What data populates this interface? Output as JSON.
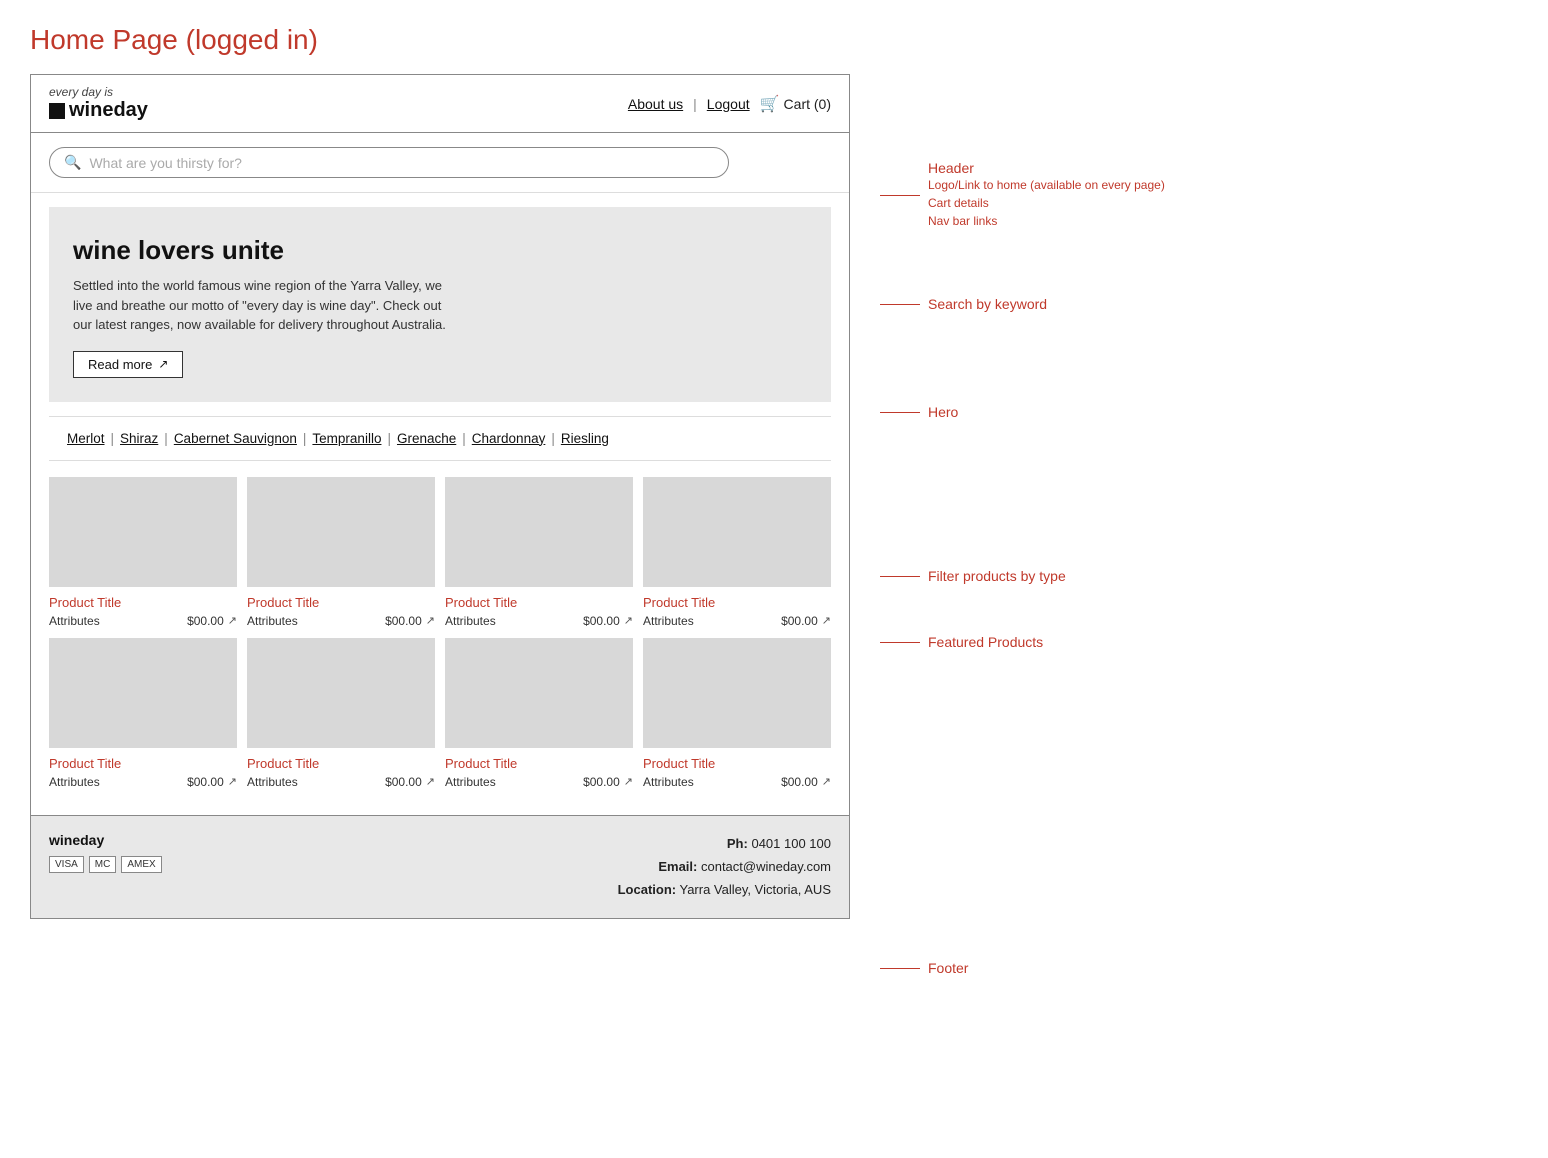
{
  "page": {
    "title": "Home Page (logged in)"
  },
  "header": {
    "logo_tagline": "every day is",
    "logo_name": "wineday",
    "nav_about": "About us",
    "nav_logout": "Logout",
    "nav_cart": "Cart (0)",
    "cart_count": "0"
  },
  "search": {
    "placeholder": "What are you thirsty for?"
  },
  "hero": {
    "title": "wine lovers unite",
    "description": "Settled into the world famous wine region of the Yarra Valley, we live and breathe our motto of \"every day is wine day\". Check out our latest ranges, now available for delivery throughout Australia.",
    "cta_label": "Read more"
  },
  "filter": {
    "links": [
      "Merlot",
      "Shiraz",
      "Cabernet Sauvignon",
      "Tempranillo",
      "Grenache",
      "Chardonnay",
      "Riesling"
    ]
  },
  "products": {
    "rows": [
      [
        {
          "title": "Product Title",
          "attributes": "Attributes",
          "price": "$00.00"
        },
        {
          "title": "Product Title",
          "attributes": "Attributes",
          "price": "$00.00"
        },
        {
          "title": "Product Title",
          "attributes": "Attributes",
          "price": "$00.00"
        },
        {
          "title": "Product Title",
          "attributes": "Attributes",
          "price": "$00.00"
        }
      ],
      [
        {
          "title": "Product Title",
          "attributes": "Attributes",
          "price": "$00.00"
        },
        {
          "title": "Product Title",
          "attributes": "Attributes",
          "price": "$00.00"
        },
        {
          "title": "Product Title",
          "attributes": "Attributes",
          "price": "$00.00"
        },
        {
          "title": "Product Title",
          "attributes": "Attributes",
          "price": "$00.00"
        }
      ]
    ]
  },
  "footer": {
    "logo_name": "wineday",
    "payment_icons": [
      "VISA",
      "MC",
      "AMEX"
    ],
    "phone_label": "Ph:",
    "phone_value": "0401 100 100",
    "email_label": "Email:",
    "email_value": "contact@wineday.com",
    "location_label": "Location:",
    "location_value": "Yarra Valley, Victoria, AUS"
  },
  "annotations": {
    "header_label": "Header",
    "header_sub1": "Logo/Link to home (available on every page)",
    "header_sub2": "Cart details",
    "header_sub3": "Nav bar links",
    "search_label": "Search by keyword",
    "hero_label": "Hero",
    "filter_label": "Filter products by type",
    "products_label": "Featured Products",
    "footer_label": "Footer"
  }
}
